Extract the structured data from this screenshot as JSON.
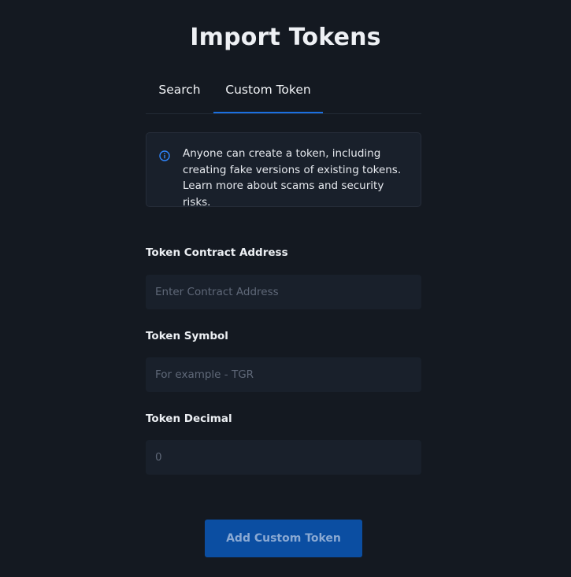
{
  "title": "Import Tokens",
  "tabs": [
    {
      "label": "Search",
      "active": false
    },
    {
      "label": "Custom Token",
      "active": true
    }
  ],
  "notice": {
    "icon": "info-icon",
    "text": "Anyone can create a token, including creating fake versions of existing tokens. Learn more about scams and security risks."
  },
  "form": {
    "contract_address": {
      "label": "Token Contract Address",
      "value": "",
      "placeholder": "Enter Contract Address"
    },
    "symbol": {
      "label": "Token Symbol",
      "value": "",
      "placeholder": "For example - TGR"
    },
    "decimal": {
      "label": "Token Decimal",
      "value": "",
      "placeholder": "0"
    }
  },
  "submit_label": "Add Custom Token",
  "colors": {
    "background": "#141921",
    "panel": "#19202b",
    "accent": "#1b6fe0",
    "button": "#0b4ea2"
  }
}
